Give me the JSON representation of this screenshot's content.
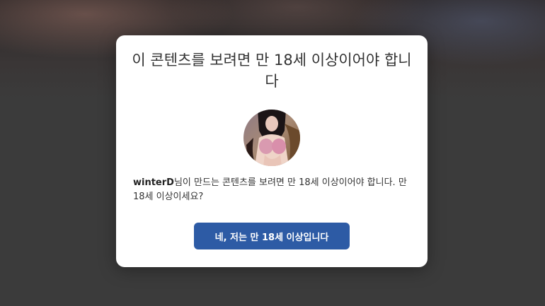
{
  "age_gate": {
    "title": "이 콘텐츠를 보려면 만 18세 이상이어야 합니다",
    "creator_name": "winterD",
    "message_after_name": "님이 만드는 콘텐츠를 보려면 만 18세 이상이어야 합니다. 만 18세 이상이세요?",
    "confirm_button_label": "네, 저는 만 18세 이상입니다",
    "avatar_icon": "creator-avatar-photo"
  },
  "colors": {
    "button_bg": "#2d5ba5",
    "modal_bg": "#ffffff",
    "overlay": "#3b3b3b"
  }
}
